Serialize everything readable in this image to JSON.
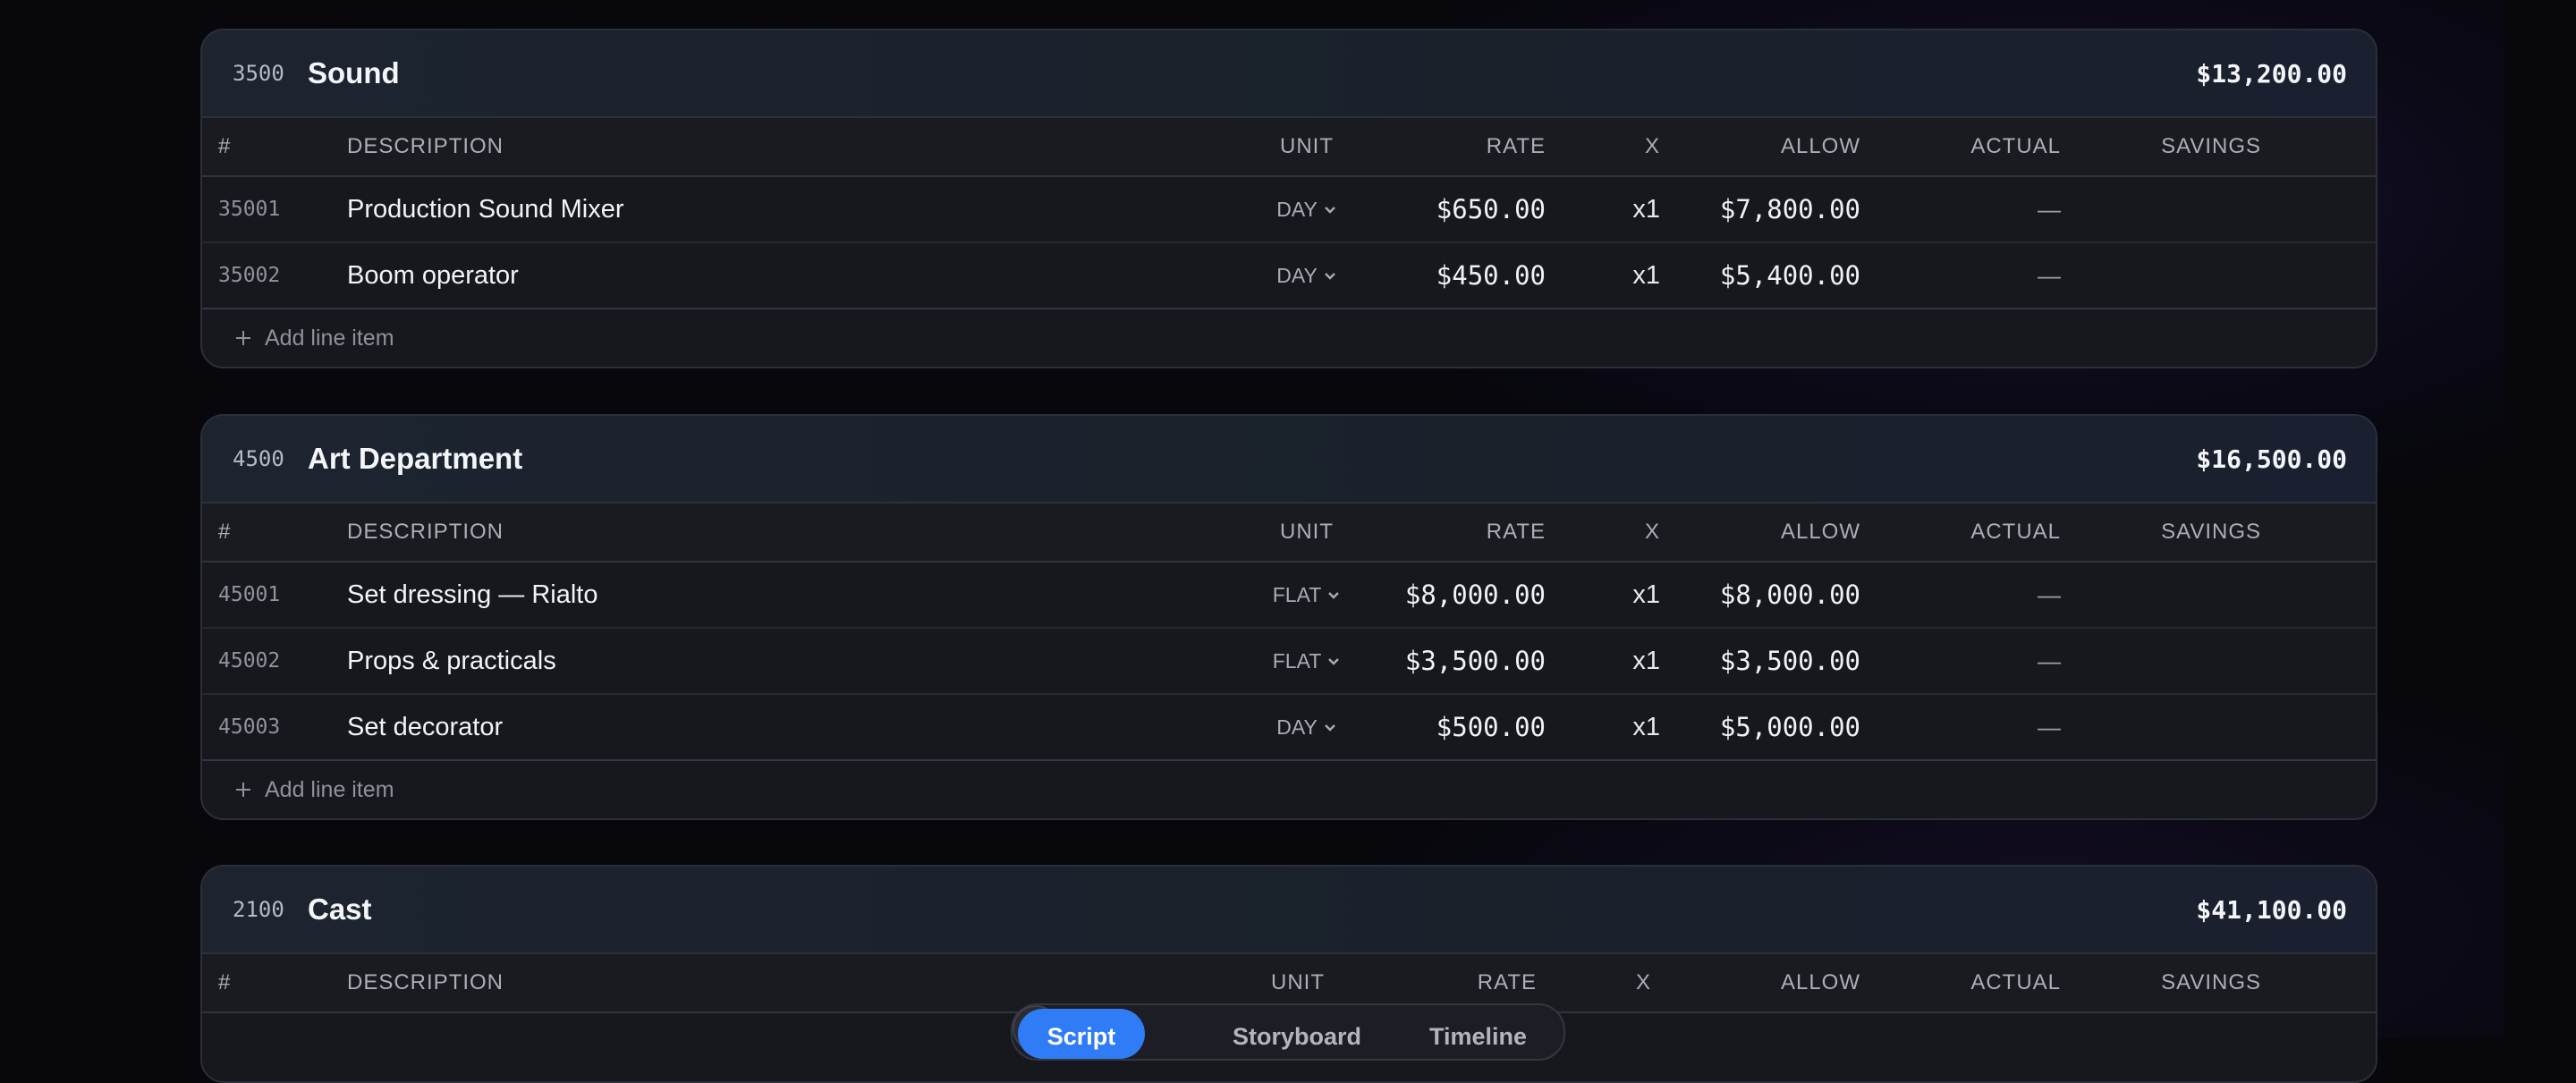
{
  "columns": {
    "num": "#",
    "description": "DESCRIPTION",
    "unit": "UNIT",
    "rate": "RATE",
    "x": "X",
    "allow": "ALLOW",
    "actual": "ACTUAL",
    "savings": "SAVINGS"
  },
  "add_line_item_label": "Add line item",
  "sections": [
    {
      "code": "3500",
      "name": "Sound",
      "total": "$13,200.00",
      "rows": [
        {
          "num": "35001",
          "description": "Production Sound Mixer",
          "unit": "DAY",
          "rate": "$650.00",
          "x": "x1",
          "allow": "$7,800.00",
          "actual": "—",
          "savings": ""
        },
        {
          "num": "35002",
          "description": "Boom operator",
          "unit": "DAY",
          "rate": "$450.00",
          "x": "x1",
          "allow": "$5,400.00",
          "actual": "—",
          "savings": ""
        }
      ]
    },
    {
      "code": "4500",
      "name": "Art Department",
      "total": "$16,500.00",
      "rows": [
        {
          "num": "45001",
          "description": "Set dressing — Rialto",
          "unit": "FLAT",
          "rate": "$8,000.00",
          "x": "x1",
          "allow": "$8,000.00",
          "actual": "—",
          "savings": ""
        },
        {
          "num": "45002",
          "description": "Props & practicals",
          "unit": "FLAT",
          "rate": "$3,500.00",
          "x": "x1",
          "allow": "$3,500.00",
          "actual": "—",
          "savings": ""
        },
        {
          "num": "45003",
          "description": "Set decorator",
          "unit": "DAY",
          "rate": "$500.00",
          "x": "x1",
          "allow": "$5,000.00",
          "actual": "—",
          "savings": ""
        }
      ]
    },
    {
      "code": "2100",
      "name": "Cast",
      "total": "$41,100.00"
    }
  ],
  "bottom_bar": {
    "script": "Script",
    "close_icon": "close-icon",
    "storyboard": "Storyboard",
    "timeline": "Timeline"
  }
}
